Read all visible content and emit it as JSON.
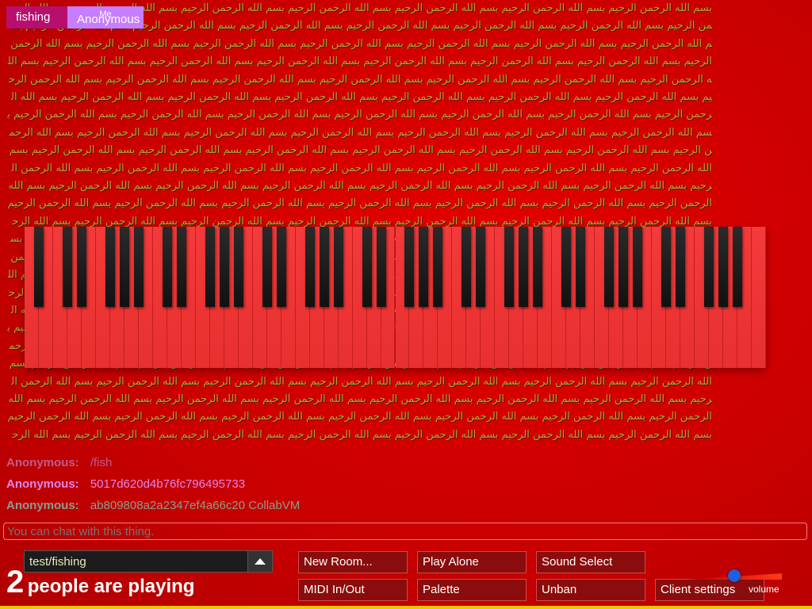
{
  "background": {
    "pattern_text": "بسم الله الرحمن الرحيم",
    "text_color": "#b79e3a"
  },
  "room_tabs": [
    {
      "label": "fishing",
      "color": "#b80e6e",
      "me_label": ""
    },
    {
      "label": "Anonymous",
      "color": "#c77dff",
      "me_label": "Me"
    }
  ],
  "piano": {
    "white_key_color": "#f03434",
    "black_key_color": "#1a1a1a"
  },
  "chat": {
    "messages": [
      {
        "name": "Anonymous:",
        "text": "/fish",
        "name_color": "#c05a8c",
        "text_color": "#c05a8c"
      },
      {
        "name": "Anonymous:",
        "text": "5017d620d4b76fc796495733",
        "name_color": "#e085e8",
        "text_color": "#e085e8"
      },
      {
        "name": "Anonymous:",
        "text": "ab809808a2a2347ef4a66c20 CollabVM",
        "name_color": "#8a9e8c",
        "text_color": "#8a9e8c"
      }
    ],
    "input_placeholder": "You can chat with this thing."
  },
  "room_select": {
    "value": "test/fishing"
  },
  "people": {
    "count": "2",
    "label": "people are playing"
  },
  "buttons": [
    {
      "label": "New Room..."
    },
    {
      "label": "Play Alone"
    },
    {
      "label": "Sound Select"
    },
    {
      "label": "MIDI In/Out"
    },
    {
      "label": "Palette"
    },
    {
      "label": "Unban"
    },
    {
      "label": "Client settings"
    }
  ],
  "volume": {
    "label": "volume",
    "level": 0.5
  },
  "colors": {
    "background": "#d40000",
    "button_bg": "#8a0c0c",
    "bottom_bar": "#e8c800"
  }
}
